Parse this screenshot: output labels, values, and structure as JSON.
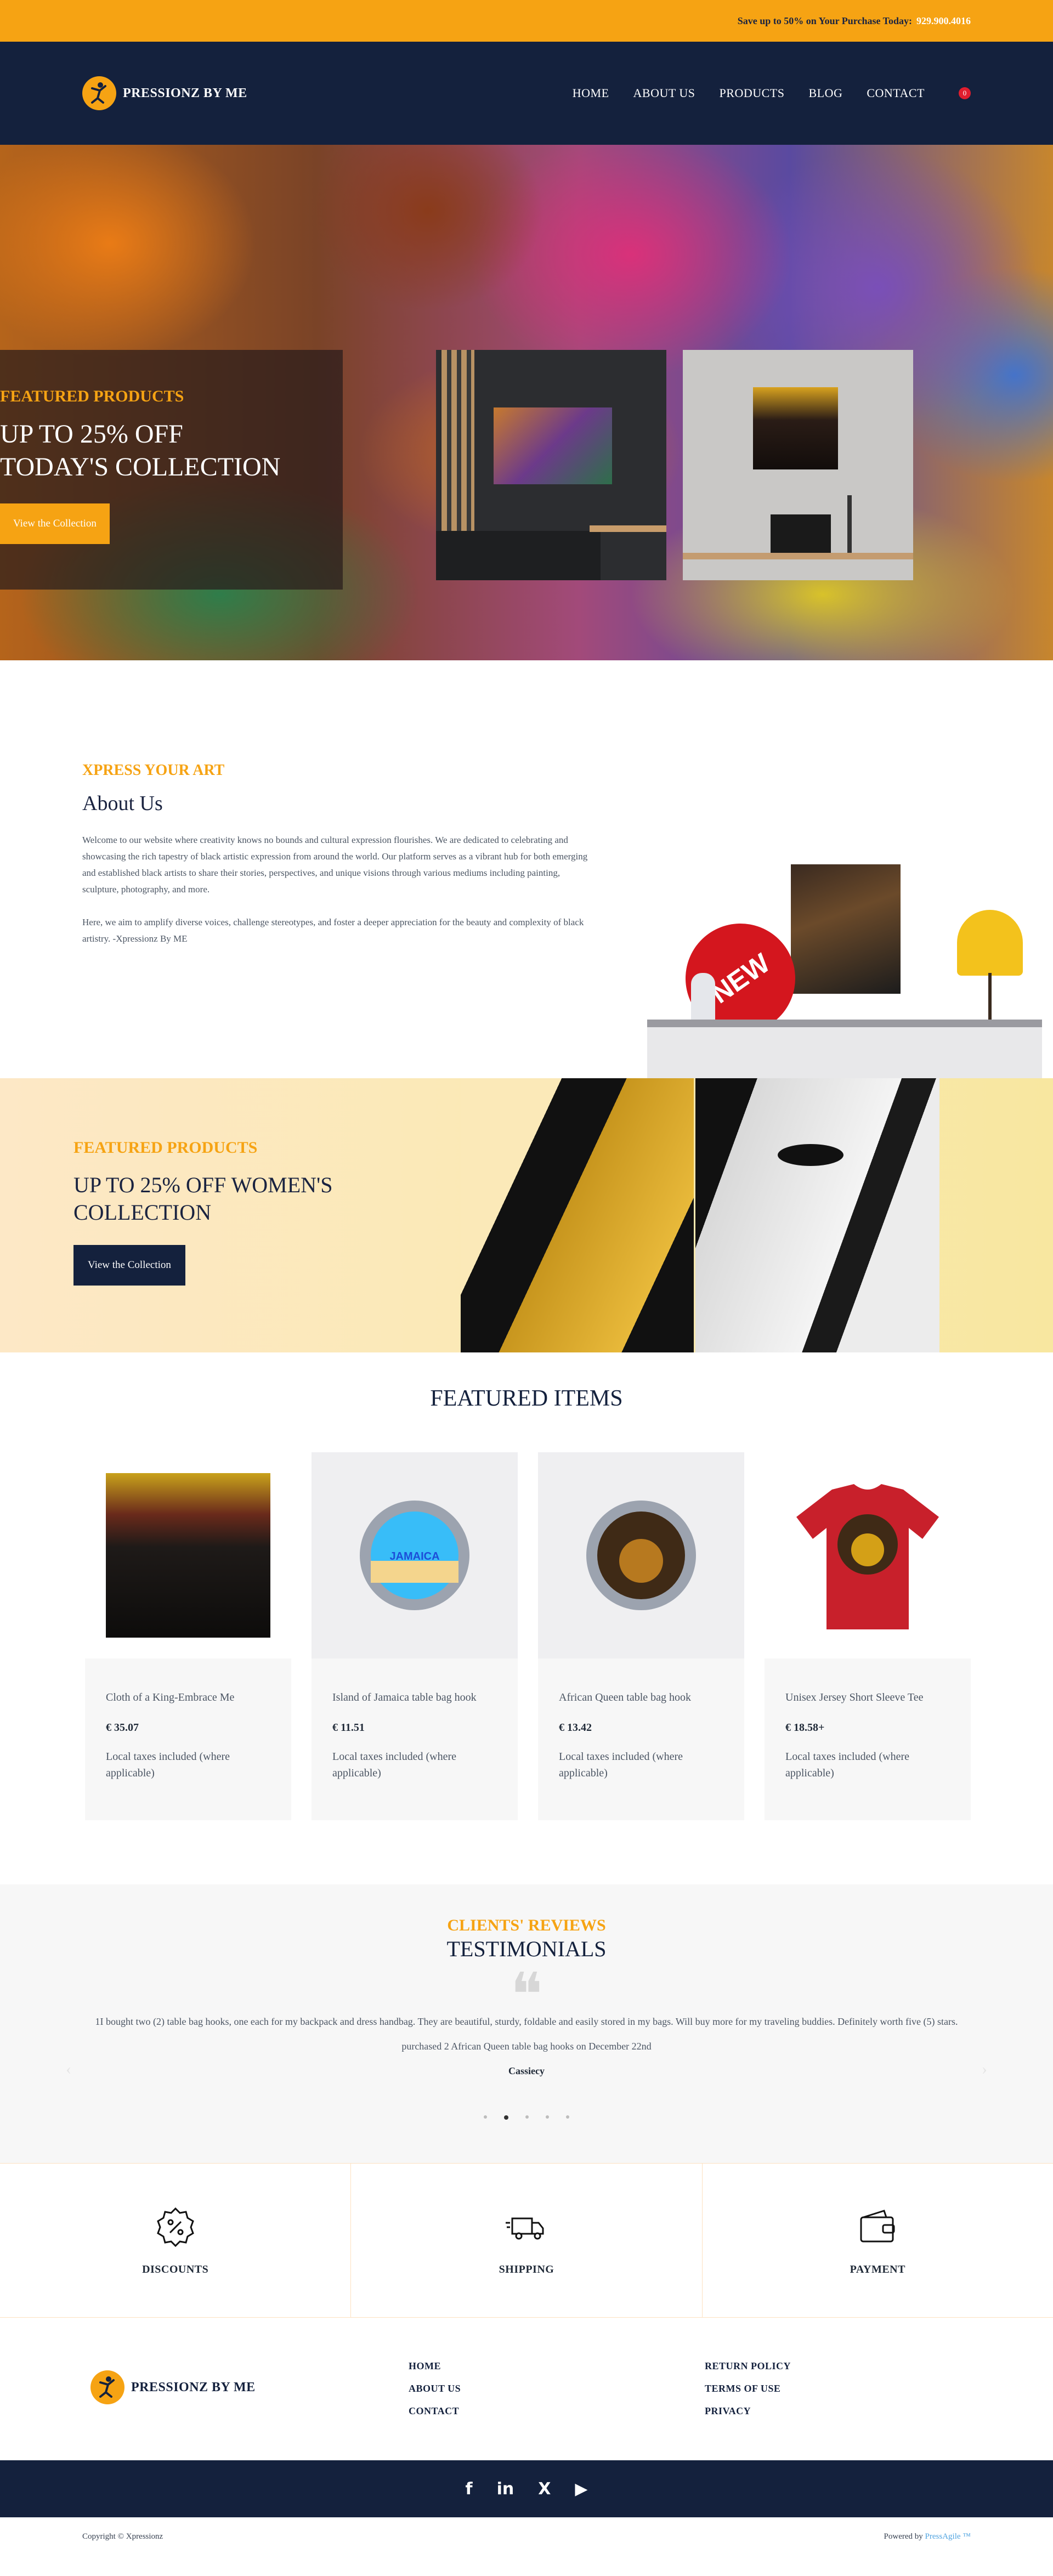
{
  "topbar": {
    "promo_text": "Save up to 50% on Your Purchase Today:",
    "phone": "929.900.4016"
  },
  "header": {
    "logo_text": "PRESSIONZ BY ME",
    "nav": [
      "HOME",
      "ABOUT US",
      "PRODUCTS",
      "BLOG",
      "CONTACT"
    ],
    "cart_count": "0"
  },
  "hero": {
    "kicker": "FEATURED PRODUCTS",
    "title_line1": "UP TO 25% OFF",
    "title_line2": "TODAY'S COLLECTION",
    "button": "View the Collection"
  },
  "about": {
    "kicker": "XPRESS YOUR ART",
    "title": "About Us",
    "para1": "Welcome to our website where creativity knows no bounds and cultural expression flourishes. We are dedicated to celebrating and showcasing the rich tapestry of black artistic expression from around the world. Our platform serves as a vibrant hub for both emerging and established black artists to share their stories, perspectives, and unique visions through various mediums including painting, sculpture, photography, and more.",
    "para2": "Here, we aim to amplify diverse voices, challenge stereotypes, and foster a deeper appreciation for the beauty and complexity of black artistry. -Xpressionz By ME",
    "badge": "NEW"
  },
  "promo": {
    "kicker": "FEATURED PRODUCTS",
    "title_line1": "UP TO 25% OFF WOMEN'S",
    "title_line2": "COLLECTION",
    "button": "View the Collection"
  },
  "featured": {
    "title": "FEATURED ITEMS",
    "items": [
      {
        "name": "Cloth of a King-Embrace Me",
        "price": "€ 35.07",
        "tax": "Local taxes included (where applicable)"
      },
      {
        "name": "Island of Jamaica table bag hook",
        "price": "€ 11.51",
        "tax": "Local taxes included (where applicable)"
      },
      {
        "name": "African Queen table bag hook",
        "price": "€ 13.42",
        "tax": "Local taxes included (where applicable)"
      },
      {
        "name": "Unisex Jersey Short Sleeve Tee",
        "price": "€ 18.58+",
        "tax": "Local taxes included (where applicable)"
      }
    ],
    "hook_label": "JAMAICA"
  },
  "testimonials": {
    "kicker": "CLIENTS' REVIEWS",
    "title": "TESTIMONIALS",
    "quote": "1I bought two (2) table bag hooks, one each for my backpack and dress handbag. They are beautiful, sturdy, foldable and easily stored in my bags. Will buy more for my traveling buddies. Definitely worth five (5) stars.",
    "purchased": "purchased 2 African Queen table bag hooks on December 22nd",
    "reviewer": "Cassiecy",
    "dot_count": 5,
    "active_dot": 1
  },
  "features": [
    "DISCOUNTS",
    "SHIPPING",
    "PAYMENT"
  ],
  "footer": {
    "logo_text": "PRESSIONZ BY ME",
    "col1": [
      "HOME",
      "ABOUT US",
      "CONTACT"
    ],
    "col2": [
      "RETURN POLICY",
      "TERMS OF USE",
      "PRIVACY"
    ],
    "social": [
      "f",
      "in",
      "X",
      "▶"
    ],
    "copyright": "Copyright © Xpressionz",
    "powered_prefix": "Powered by",
    "powered_brand": "PressAgile ™"
  },
  "colors": {
    "accent": "#f6a313",
    "navy": "#14213d",
    "cart_badge": "#e11d2e"
  }
}
